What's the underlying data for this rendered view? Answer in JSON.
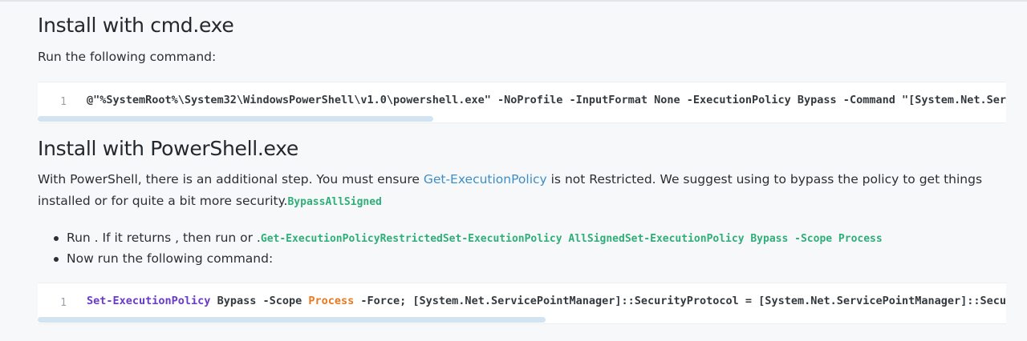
{
  "section1": {
    "heading": "Install with cmd.exe",
    "intro": "Run the following command:",
    "code": {
      "line_number": "1",
      "text": "@\"%SystemRoot%\\System32\\WindowsPowerShell\\v1.0\\powershell.exe\" -NoProfile -InputFormat None -ExecutionPolicy Bypass -Command \"[System.Net.ServicePointManager]::SecurityProtocol"
    }
  },
  "section2": {
    "heading": "Install with PowerShell.exe",
    "para_before_link": "With PowerShell, there is an additional step. You must ensure ",
    "link_text": "Get-ExecutionPolicy",
    "para_after_link": " is not Restricted. We suggest using to bypass the policy to get things",
    "para_line2": "installed or for quite a bit more security.",
    "para_inline_code": "BypassAllSigned",
    "bullets": [
      {
        "text": "Run . If it returns , then run or .",
        "code": "Get-ExecutionPolicyRestrictedSet-ExecutionPolicy AllSignedSet-ExecutionPolicy Bypass -Scope Process"
      },
      {
        "text": "Now run the following command:"
      }
    ],
    "code": {
      "line_number": "1",
      "part1": "Set-ExecutionPolicy",
      "part2": " Bypass -Scope ",
      "part3": "Process",
      "part4": " -Force; [System.Net.ServicePointManager]::SecurityProtocol = [System.Net.ServicePointManager]::SecurityProtocol"
    }
  },
  "colors": {
    "link": "#3d8ec7",
    "inline_code": "#2fae7a",
    "keyword_purple": "#6a3bc9",
    "keyword_orange": "#e9781e",
    "scrollbar": "#d2e4f2"
  }
}
